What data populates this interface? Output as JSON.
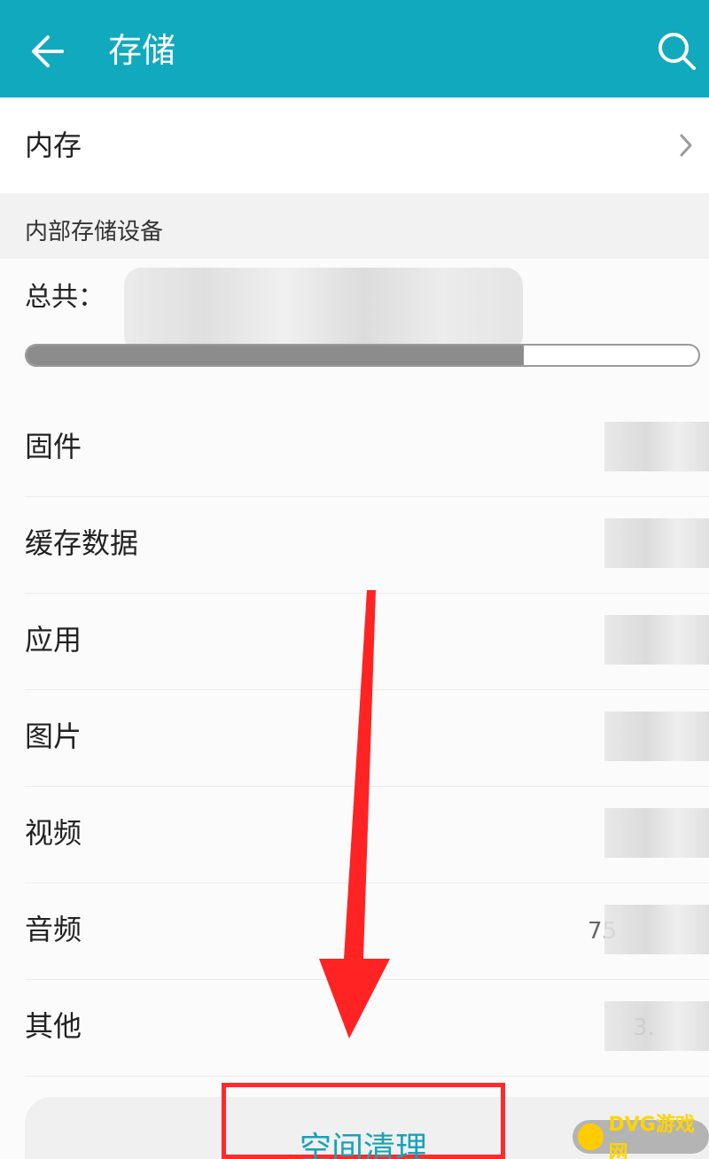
{
  "header": {
    "title": "存储",
    "back_icon": "back-arrow-icon",
    "search_icon": "search-icon"
  },
  "memory_row": {
    "label": "内存",
    "chevron_icon": "chevron-right-icon"
  },
  "section": {
    "title": "内部存储设备"
  },
  "total": {
    "label": "总共：",
    "used_fraction": 0.74
  },
  "items": [
    {
      "label": "固件",
      "value": ""
    },
    {
      "label": "缓存数据",
      "value": ""
    },
    {
      "label": "应用",
      "value": ""
    },
    {
      "label": "图片",
      "value": ""
    },
    {
      "label": "视频",
      "value": ""
    },
    {
      "label": "音频",
      "value": "75"
    },
    {
      "label": "其他",
      "value": "3."
    }
  ],
  "cleanup_button": {
    "label": "空间清理"
  },
  "colors": {
    "appbar": "#11a9bd",
    "accent_text": "#17a2b8",
    "highlight_red": "#ff2a2a"
  },
  "watermark": {
    "text": "DVG游戏网"
  }
}
